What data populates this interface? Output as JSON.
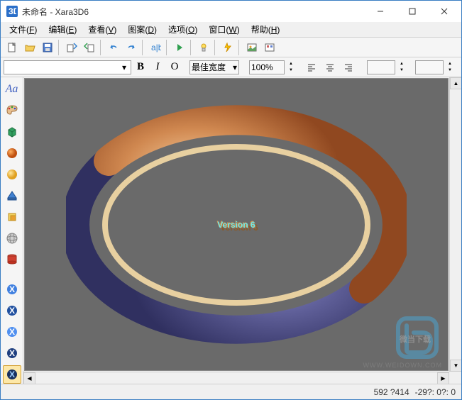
{
  "window": {
    "title": "未命名 - Xara3D6"
  },
  "menu": {
    "file": "文件(<u>F</u>)",
    "edit": "编辑(<u>E</u>)",
    "view": "查看(<u>V</u>)",
    "pattern": "图案(<u>D</u>)",
    "options": "选项(<u>O</u>)",
    "window": "窗口(<u>W</u>)",
    "help": "帮助(<u>H</u>)"
  },
  "toolbar2": {
    "bold": "B",
    "italic": "I",
    "outline": "O",
    "fit_label": "最佳宽度",
    "zoom": "100%"
  },
  "canvas": {
    "text3d": "Version 6"
  },
  "status": {
    "coords": "592 ?414",
    "angle": "-29?: 0?: 0"
  },
  "watermark": {
    "brand": "微当下载",
    "url": "WWW.WEIDOWN.COM"
  }
}
